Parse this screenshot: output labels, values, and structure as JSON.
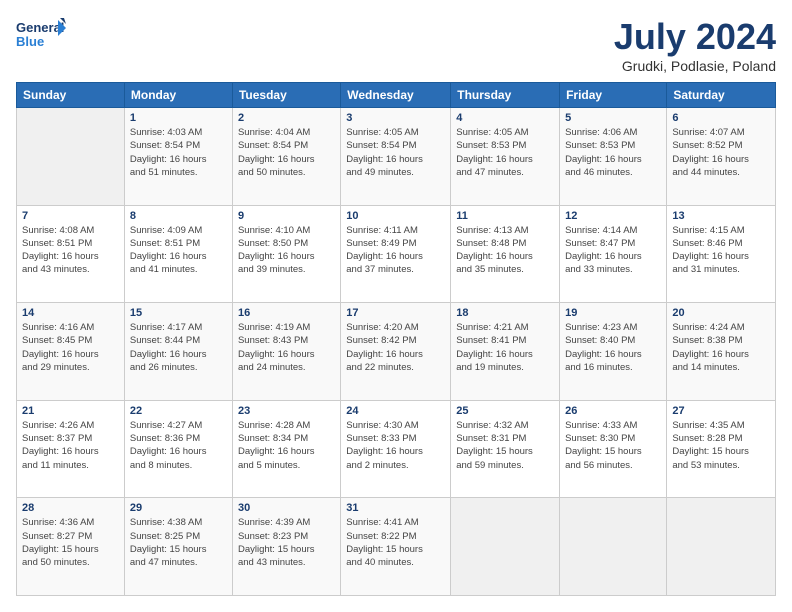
{
  "header": {
    "logo_line1": "General",
    "logo_line2": "Blue",
    "title": "July 2024",
    "subtitle": "Grudki, Podlasie, Poland"
  },
  "columns": [
    "Sunday",
    "Monday",
    "Tuesday",
    "Wednesday",
    "Thursday",
    "Friday",
    "Saturday"
  ],
  "weeks": [
    [
      {
        "day": "",
        "info": ""
      },
      {
        "day": "1",
        "info": "Sunrise: 4:03 AM\nSunset: 8:54 PM\nDaylight: 16 hours\nand 51 minutes."
      },
      {
        "day": "2",
        "info": "Sunrise: 4:04 AM\nSunset: 8:54 PM\nDaylight: 16 hours\nand 50 minutes."
      },
      {
        "day": "3",
        "info": "Sunrise: 4:05 AM\nSunset: 8:54 PM\nDaylight: 16 hours\nand 49 minutes."
      },
      {
        "day": "4",
        "info": "Sunrise: 4:05 AM\nSunset: 8:53 PM\nDaylight: 16 hours\nand 47 minutes."
      },
      {
        "day": "5",
        "info": "Sunrise: 4:06 AM\nSunset: 8:53 PM\nDaylight: 16 hours\nand 46 minutes."
      },
      {
        "day": "6",
        "info": "Sunrise: 4:07 AM\nSunset: 8:52 PM\nDaylight: 16 hours\nand 44 minutes."
      }
    ],
    [
      {
        "day": "7",
        "info": "Sunrise: 4:08 AM\nSunset: 8:51 PM\nDaylight: 16 hours\nand 43 minutes."
      },
      {
        "day": "8",
        "info": "Sunrise: 4:09 AM\nSunset: 8:51 PM\nDaylight: 16 hours\nand 41 minutes."
      },
      {
        "day": "9",
        "info": "Sunrise: 4:10 AM\nSunset: 8:50 PM\nDaylight: 16 hours\nand 39 minutes."
      },
      {
        "day": "10",
        "info": "Sunrise: 4:11 AM\nSunset: 8:49 PM\nDaylight: 16 hours\nand 37 minutes."
      },
      {
        "day": "11",
        "info": "Sunrise: 4:13 AM\nSunset: 8:48 PM\nDaylight: 16 hours\nand 35 minutes."
      },
      {
        "day": "12",
        "info": "Sunrise: 4:14 AM\nSunset: 8:47 PM\nDaylight: 16 hours\nand 33 minutes."
      },
      {
        "day": "13",
        "info": "Sunrise: 4:15 AM\nSunset: 8:46 PM\nDaylight: 16 hours\nand 31 minutes."
      }
    ],
    [
      {
        "day": "14",
        "info": "Sunrise: 4:16 AM\nSunset: 8:45 PM\nDaylight: 16 hours\nand 29 minutes."
      },
      {
        "day": "15",
        "info": "Sunrise: 4:17 AM\nSunset: 8:44 PM\nDaylight: 16 hours\nand 26 minutes."
      },
      {
        "day": "16",
        "info": "Sunrise: 4:19 AM\nSunset: 8:43 PM\nDaylight: 16 hours\nand 24 minutes."
      },
      {
        "day": "17",
        "info": "Sunrise: 4:20 AM\nSunset: 8:42 PM\nDaylight: 16 hours\nand 22 minutes."
      },
      {
        "day": "18",
        "info": "Sunrise: 4:21 AM\nSunset: 8:41 PM\nDaylight: 16 hours\nand 19 minutes."
      },
      {
        "day": "19",
        "info": "Sunrise: 4:23 AM\nSunset: 8:40 PM\nDaylight: 16 hours\nand 16 minutes."
      },
      {
        "day": "20",
        "info": "Sunrise: 4:24 AM\nSunset: 8:38 PM\nDaylight: 16 hours\nand 14 minutes."
      }
    ],
    [
      {
        "day": "21",
        "info": "Sunrise: 4:26 AM\nSunset: 8:37 PM\nDaylight: 16 hours\nand 11 minutes."
      },
      {
        "day": "22",
        "info": "Sunrise: 4:27 AM\nSunset: 8:36 PM\nDaylight: 16 hours\nand 8 minutes."
      },
      {
        "day": "23",
        "info": "Sunrise: 4:28 AM\nSunset: 8:34 PM\nDaylight: 16 hours\nand 5 minutes."
      },
      {
        "day": "24",
        "info": "Sunrise: 4:30 AM\nSunset: 8:33 PM\nDaylight: 16 hours\nand 2 minutes."
      },
      {
        "day": "25",
        "info": "Sunrise: 4:32 AM\nSunset: 8:31 PM\nDaylight: 15 hours\nand 59 minutes."
      },
      {
        "day": "26",
        "info": "Sunrise: 4:33 AM\nSunset: 8:30 PM\nDaylight: 15 hours\nand 56 minutes."
      },
      {
        "day": "27",
        "info": "Sunrise: 4:35 AM\nSunset: 8:28 PM\nDaylight: 15 hours\nand 53 minutes."
      }
    ],
    [
      {
        "day": "28",
        "info": "Sunrise: 4:36 AM\nSunset: 8:27 PM\nDaylight: 15 hours\nand 50 minutes."
      },
      {
        "day": "29",
        "info": "Sunrise: 4:38 AM\nSunset: 8:25 PM\nDaylight: 15 hours\nand 47 minutes."
      },
      {
        "day": "30",
        "info": "Sunrise: 4:39 AM\nSunset: 8:23 PM\nDaylight: 15 hours\nand 43 minutes."
      },
      {
        "day": "31",
        "info": "Sunrise: 4:41 AM\nSunset: 8:22 PM\nDaylight: 15 hours\nand 40 minutes."
      },
      {
        "day": "",
        "info": ""
      },
      {
        "day": "",
        "info": ""
      },
      {
        "day": "",
        "info": ""
      }
    ]
  ]
}
